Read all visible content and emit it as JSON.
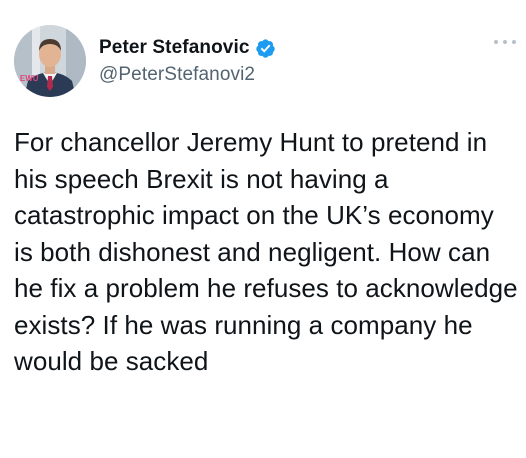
{
  "author": {
    "display_name": "Peter Stefanovic",
    "handle": "@PeterStefanovi2",
    "verified": true,
    "verified_icon": "verified-badge-icon",
    "avatar_badge_text": "LEWU"
  },
  "menu": {
    "icon": "more-horizontal-icon"
  },
  "tweet": {
    "text": "For chancellor Jeremy Hunt to pretend in his speech Brexit is not having a catastrophic impact on the UK’s economy is both dishonest and negligent. How can he fix a problem he refuses to acknowledge exists? If he was running a company he would be sacked"
  },
  "colors": {
    "text_primary": "#0f1419",
    "text_secondary": "#536471",
    "verified_blue": "#1d9bf0",
    "avatar_badge": "#e0457b"
  }
}
